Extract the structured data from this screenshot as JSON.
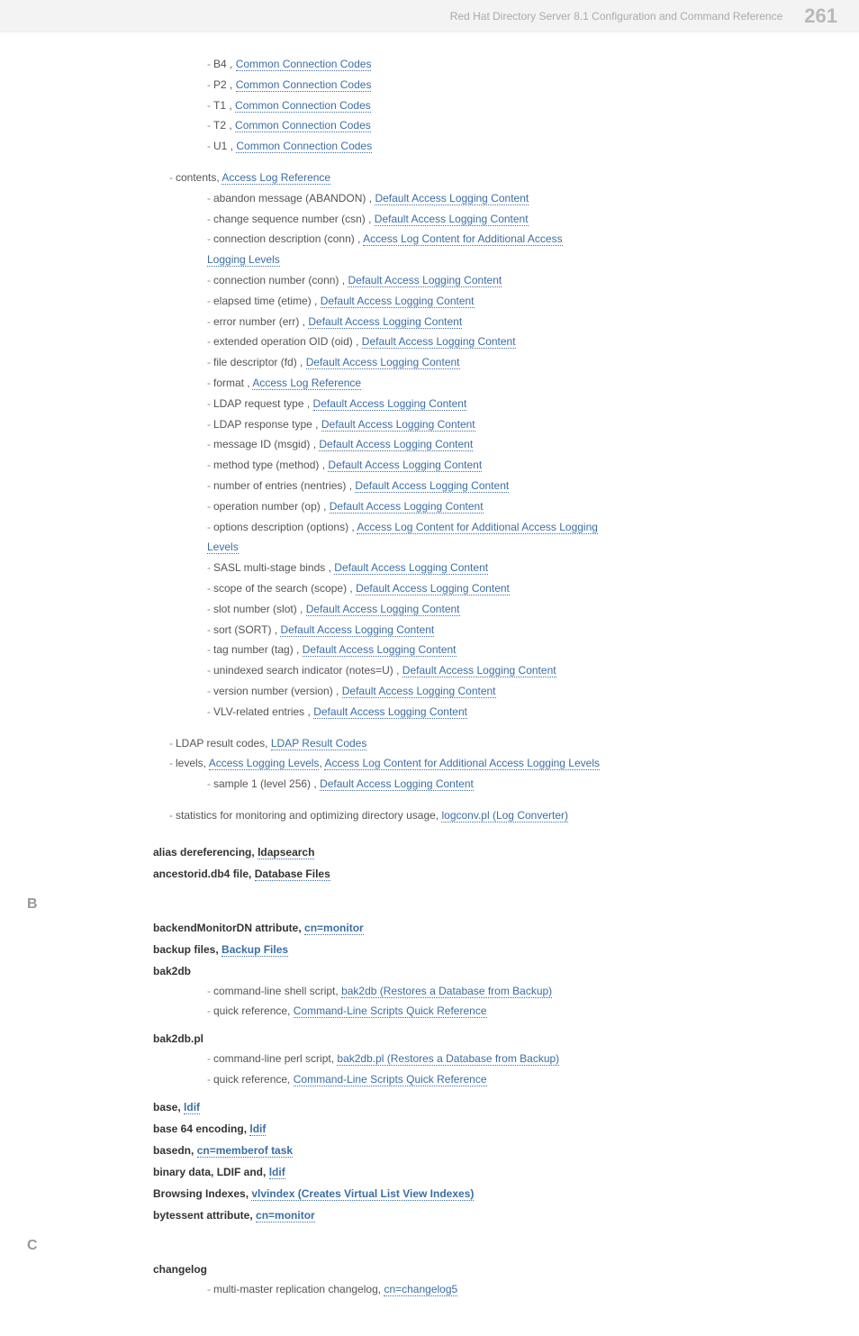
{
  "header": {
    "title": "Red Hat Directory Server 8.1 Configuration and Command Reference",
    "page": "261"
  },
  "codes": {
    "b4": "B4",
    "p2": "P2",
    "t1": "T1",
    "t2": "T2",
    "u1": "U1",
    "ccc": "Common Connection Codes"
  },
  "contents_head": {
    "label": "contents,",
    "link": "Access Log Reference"
  },
  "contents": [
    {
      "label": "abandon message (ABANDON) ,",
      "link": "Default Access Logging Content"
    },
    {
      "label": "change sequence number (csn) ,",
      "link": "Default Access Logging Content"
    },
    {
      "label": "connection description (conn) ,",
      "link": "Access Log Content for Additional Access",
      "cont": {
        "link": "Logging Levels"
      }
    },
    {
      "label": "connection number (conn) ,",
      "link": "Default Access Logging Content"
    },
    {
      "label": "elapsed time (etime) ,",
      "link": "Default Access Logging Content"
    },
    {
      "label": "error number (err) ,",
      "link": "Default Access Logging Content"
    },
    {
      "label": "extended operation OID (oid) ,",
      "link": "Default Access Logging Content"
    },
    {
      "label": "file descriptor (fd) ,",
      "link": "Default Access Logging Content"
    },
    {
      "label": "format ,",
      "link": "Access Log Reference"
    },
    {
      "label": "LDAP request type ,",
      "link": "Default Access Logging Content"
    },
    {
      "label": "LDAP response type ,",
      "link": "Default Access Logging Content"
    },
    {
      "label": "message ID (msgid) ,",
      "link": "Default Access Logging Content"
    },
    {
      "label": "method type (method) ,",
      "link": "Default Access Logging Content"
    },
    {
      "label": "number of entries (nentries) ,",
      "link": "Default Access Logging Content"
    },
    {
      "label": "operation number (op) ,",
      "link": "Default Access Logging Content"
    },
    {
      "label": "options description (options) ,",
      "link": "Access Log Content for Additional Access Logging",
      "cont": {
        "link": "Levels"
      }
    },
    {
      "label": "SASL multi-stage binds ,",
      "link": "Default Access Logging Content"
    },
    {
      "label": "scope of the search (scope) ,",
      "link": "Default Access Logging Content"
    },
    {
      "label": "slot number (slot) ,",
      "link": "Default Access Logging Content"
    },
    {
      "label": "sort (SORT) ,",
      "link": "Default Access Logging Content"
    },
    {
      "label": "tag number (tag) ,",
      "link": "Default Access Logging Content"
    },
    {
      "label": "unindexed search indicator (notes=U) ,",
      "link": "Default Access Logging Content"
    },
    {
      "label": "version number (version) ,",
      "link": "Default Access Logging Content"
    },
    {
      "label": "VLV-related entries ,",
      "link": "Default Access Logging Content"
    }
  ],
  "ldap_result": {
    "label": "LDAP result codes,",
    "link": "LDAP Result Codes"
  },
  "levels": {
    "label": "levels,",
    "link1": "Access Logging Levels",
    "sep": ",",
    "link2": "Access Log Content for Additional Access Logging Levels",
    "sample_label": "sample 1 (level 256) ,",
    "sample_link": "Default Access Logging Content"
  },
  "stats": {
    "label": "statistics for monitoring and optimizing directory usage,",
    "link": "logconv.pl (Log Converter)"
  },
  "alias": {
    "term": "alias dereferencing,",
    "link": "ldapsearch"
  },
  "ancestorid": {
    "term": "ancestorid.db4 file,",
    "link": "Database Files"
  },
  "section_b": "B",
  "backend": {
    "term": "backendMonitorDN attribute,",
    "link": "cn=monitor"
  },
  "backupfiles": {
    "term": "backup files,",
    "link": "Backup Files"
  },
  "bak2db": {
    "term": "bak2db",
    "l1_label": "command-line shell script,",
    "l1_link": "bak2db (Restores a Database from Backup)",
    "l2_label": "quick reference,",
    "l2_link": "Command-Line Scripts Quick Reference"
  },
  "bak2dbpl": {
    "term": "bak2db.pl",
    "l1_label": "command-line perl script,",
    "l1_link": "bak2db.pl (Restores a Database from Backup)",
    "l2_label": "quick reference,",
    "l2_link": "Command-Line Scripts Quick Reference"
  },
  "base": {
    "term": "base,",
    "link": "ldif"
  },
  "base64": {
    "term": "base 64 encoding,",
    "link": "ldif"
  },
  "basedn": {
    "term": "basedn,",
    "link": "cn=memberof task"
  },
  "binary": {
    "term": "binary data, LDIF and,",
    "link": "ldif"
  },
  "browsing": {
    "term": "Browsing Indexes,",
    "link": "vlvindex (Creates Virtual List View Indexes)"
  },
  "bytessent": {
    "term": "bytessent attribute,",
    "link": "cn=monitor"
  },
  "section_c": "C",
  "changelog": {
    "term": "changelog",
    "l1_label": "multi-master replication changelog,",
    "l1_link": "cn=changelog5"
  }
}
